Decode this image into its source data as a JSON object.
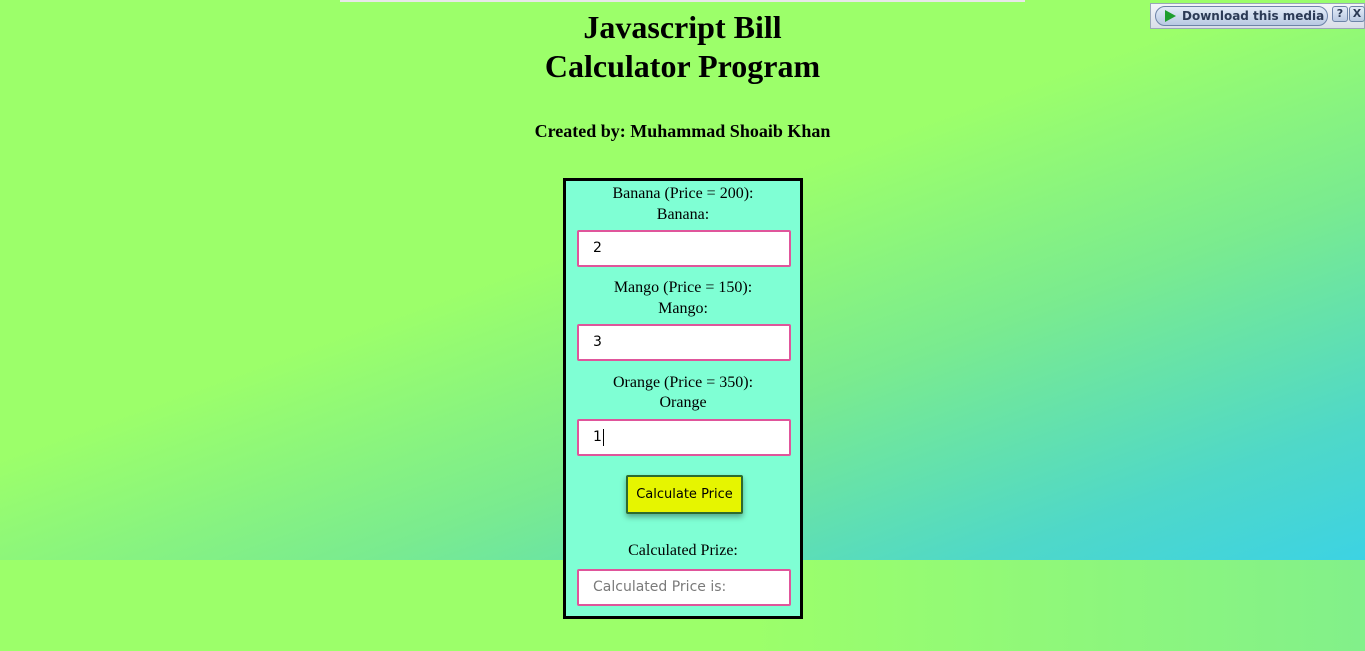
{
  "header": {
    "title_line1": "Javascript Bill",
    "title_line2": "Calculator Program",
    "author": "Created by: Muhammad Shoaib Khan"
  },
  "form": {
    "banana": {
      "price_label": "Banana (Price = 200):",
      "field_label": "Banana:",
      "value": "2"
    },
    "mango": {
      "price_label": "Mango (Price = 150):",
      "field_label": "Mango:",
      "value": "3"
    },
    "orange": {
      "price_label": "Orange (Price = 350):",
      "field_label": "Orange",
      "value": "1"
    },
    "calculate_button": "Calculate Price",
    "result_label": "Calculated Prize:",
    "result_placeholder": "Calculated Price is:"
  },
  "media_toolbar": {
    "download_label": "Download this media",
    "help_label": "?",
    "close_label": "X",
    "icons": [
      "play-icon"
    ]
  },
  "colors": {
    "card_bg": "#7fffd4",
    "field_border": "#e0559b",
    "button_bg": "#e6f500",
    "page_green": "#9cff6a",
    "page_cyan": "#30cff5"
  }
}
